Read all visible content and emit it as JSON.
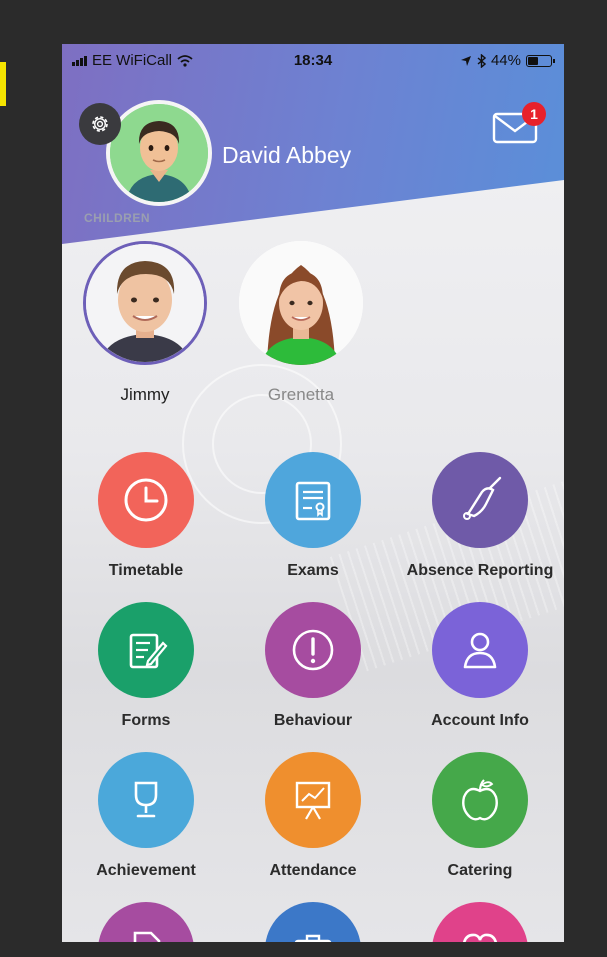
{
  "status_bar": {
    "carrier": "EE WiFiCall",
    "time": "18:34",
    "battery": "44%",
    "battery_level": 0.44
  },
  "header": {
    "parent_name": "David Abbey",
    "mail_badge_count": "1",
    "colors": {
      "band_start": "#7e6fc2",
      "band_end": "#5a8fd9",
      "badge": "#e8212b"
    }
  },
  "children": {
    "section_label": "CHILDREN",
    "items": [
      {
        "name": "Jimmy",
        "selected": true
      },
      {
        "name": "Grenetta",
        "selected": false
      }
    ]
  },
  "menu": {
    "items": [
      {
        "label": "Timetable",
        "icon": "clock-icon",
        "color": "#f2645a"
      },
      {
        "label": "Exams",
        "icon": "certificate-icon",
        "color": "#4fa6dc"
      },
      {
        "label": "Absence Reporting",
        "icon": "bell-icon",
        "color": "#6f5aa8"
      },
      {
        "label": "Forms",
        "icon": "form-edit-icon",
        "color": "#1aa06a"
      },
      {
        "label": "Behaviour",
        "icon": "exclamation-icon",
        "color": "#a64ca0"
      },
      {
        "label": "Account Info",
        "icon": "user-icon",
        "color": "#7b63d8"
      },
      {
        "label": "Achievement",
        "icon": "trophy-icon",
        "color": "#4ba8da"
      },
      {
        "label": "Attendance",
        "icon": "presentation-chart-icon",
        "color": "#ef8f2e"
      },
      {
        "label": "Catering",
        "icon": "apple-icon",
        "color": "#45a84a"
      },
      {
        "label": "",
        "icon": "document-icon",
        "color": "#a64ca0"
      },
      {
        "label": "",
        "icon": "briefcase-icon",
        "color": "#3c78c8"
      },
      {
        "label": "",
        "icon": "heart-icon",
        "color": "#e0428a"
      }
    ]
  }
}
